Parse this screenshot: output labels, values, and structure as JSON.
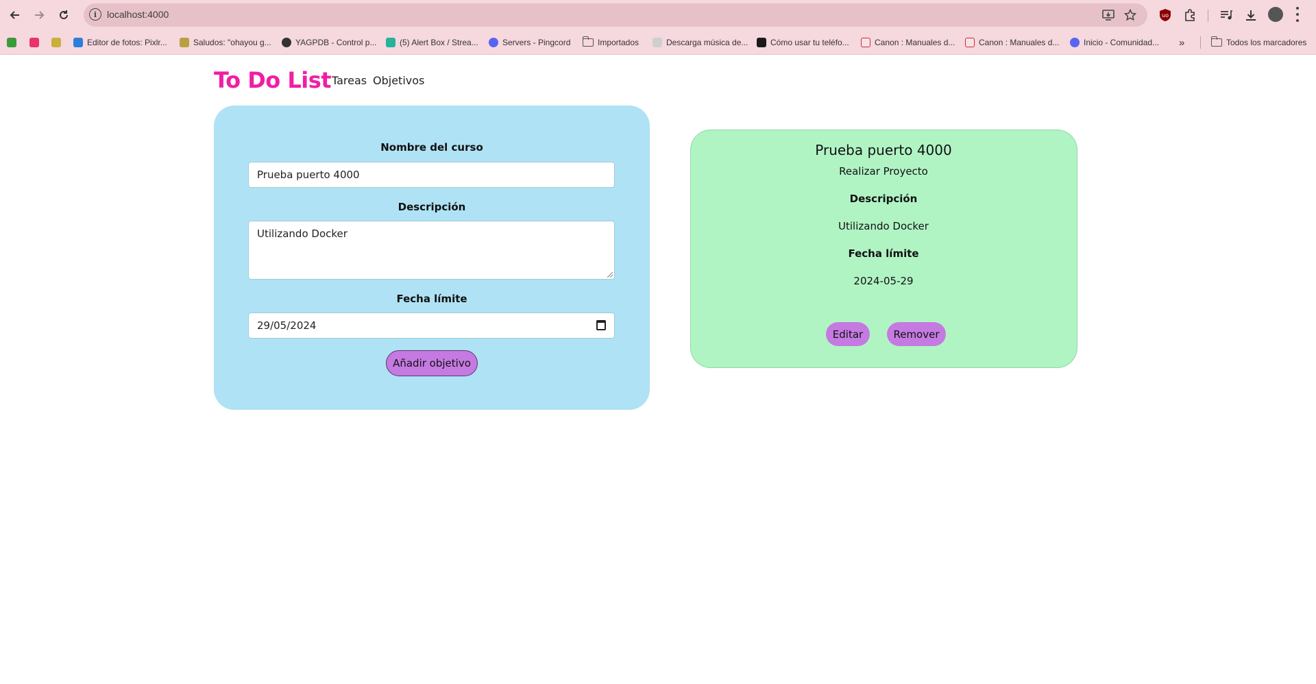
{
  "browser": {
    "url": "localhost:4000",
    "bookmarks": [
      {
        "label": "",
        "color": "#3a9b3a"
      },
      {
        "label": "",
        "color": "#e8336b"
      },
      {
        "label": "",
        "color": "#c9b03a"
      },
      {
        "label": "Editor de fotos: Pixlr...",
        "color": "#2b7fd8"
      },
      {
        "label": "Saludos: \"ohayou g...",
        "color": "#b9a040"
      },
      {
        "label": "YAGPDB - Control p...",
        "color": "#333333"
      },
      {
        "label": "(5) Alert Box / Strea...",
        "color": "#25b39a"
      },
      {
        "label": "Servers - Pingcord",
        "color": "#5865f2"
      },
      {
        "label": "Importados",
        "icon": "folder-icon"
      },
      {
        "label": "Descarga música de...",
        "color": "#999999"
      },
      {
        "label": "Cómo usar tu teléfo...",
        "color": "#1a1a1a"
      },
      {
        "label": "Canon : Manuales d...",
        "color": "#d8262f"
      },
      {
        "label": "Canon : Manuales d...",
        "color": "#d8262f"
      },
      {
        "label": "Inicio - Comunidad...",
        "color": "#5865f2"
      }
    ],
    "all_bookmarks": "Todos los marcadores"
  },
  "app": {
    "brand": "To Do List",
    "nav": [
      "Tareas",
      "Objetivos"
    ]
  },
  "form": {
    "course_label": "Nombre del curso",
    "course_value": "Prueba puerto 4000",
    "description_label": "Descripción",
    "description_value": "Utilizando Docker",
    "deadline_label": "Fecha límite",
    "deadline_value": "29/05/2024",
    "submit_label": "Añadir objetivo"
  },
  "goal": {
    "title": "Prueba puerto 4000",
    "subtitle": "Realizar Proyecto",
    "description_label": "Descripción",
    "description": "Utilizando Docker",
    "deadline_label": "Fecha límite",
    "deadline": "2024-05-29",
    "edit_label": "Editar",
    "remove_label": "Remover"
  },
  "colors": {
    "brand": "#f01ea5",
    "form_card": "#afe2f4",
    "goal_card": "#b1f4c4",
    "button": "#c57ae2",
    "chrome": "#f6d8df"
  }
}
